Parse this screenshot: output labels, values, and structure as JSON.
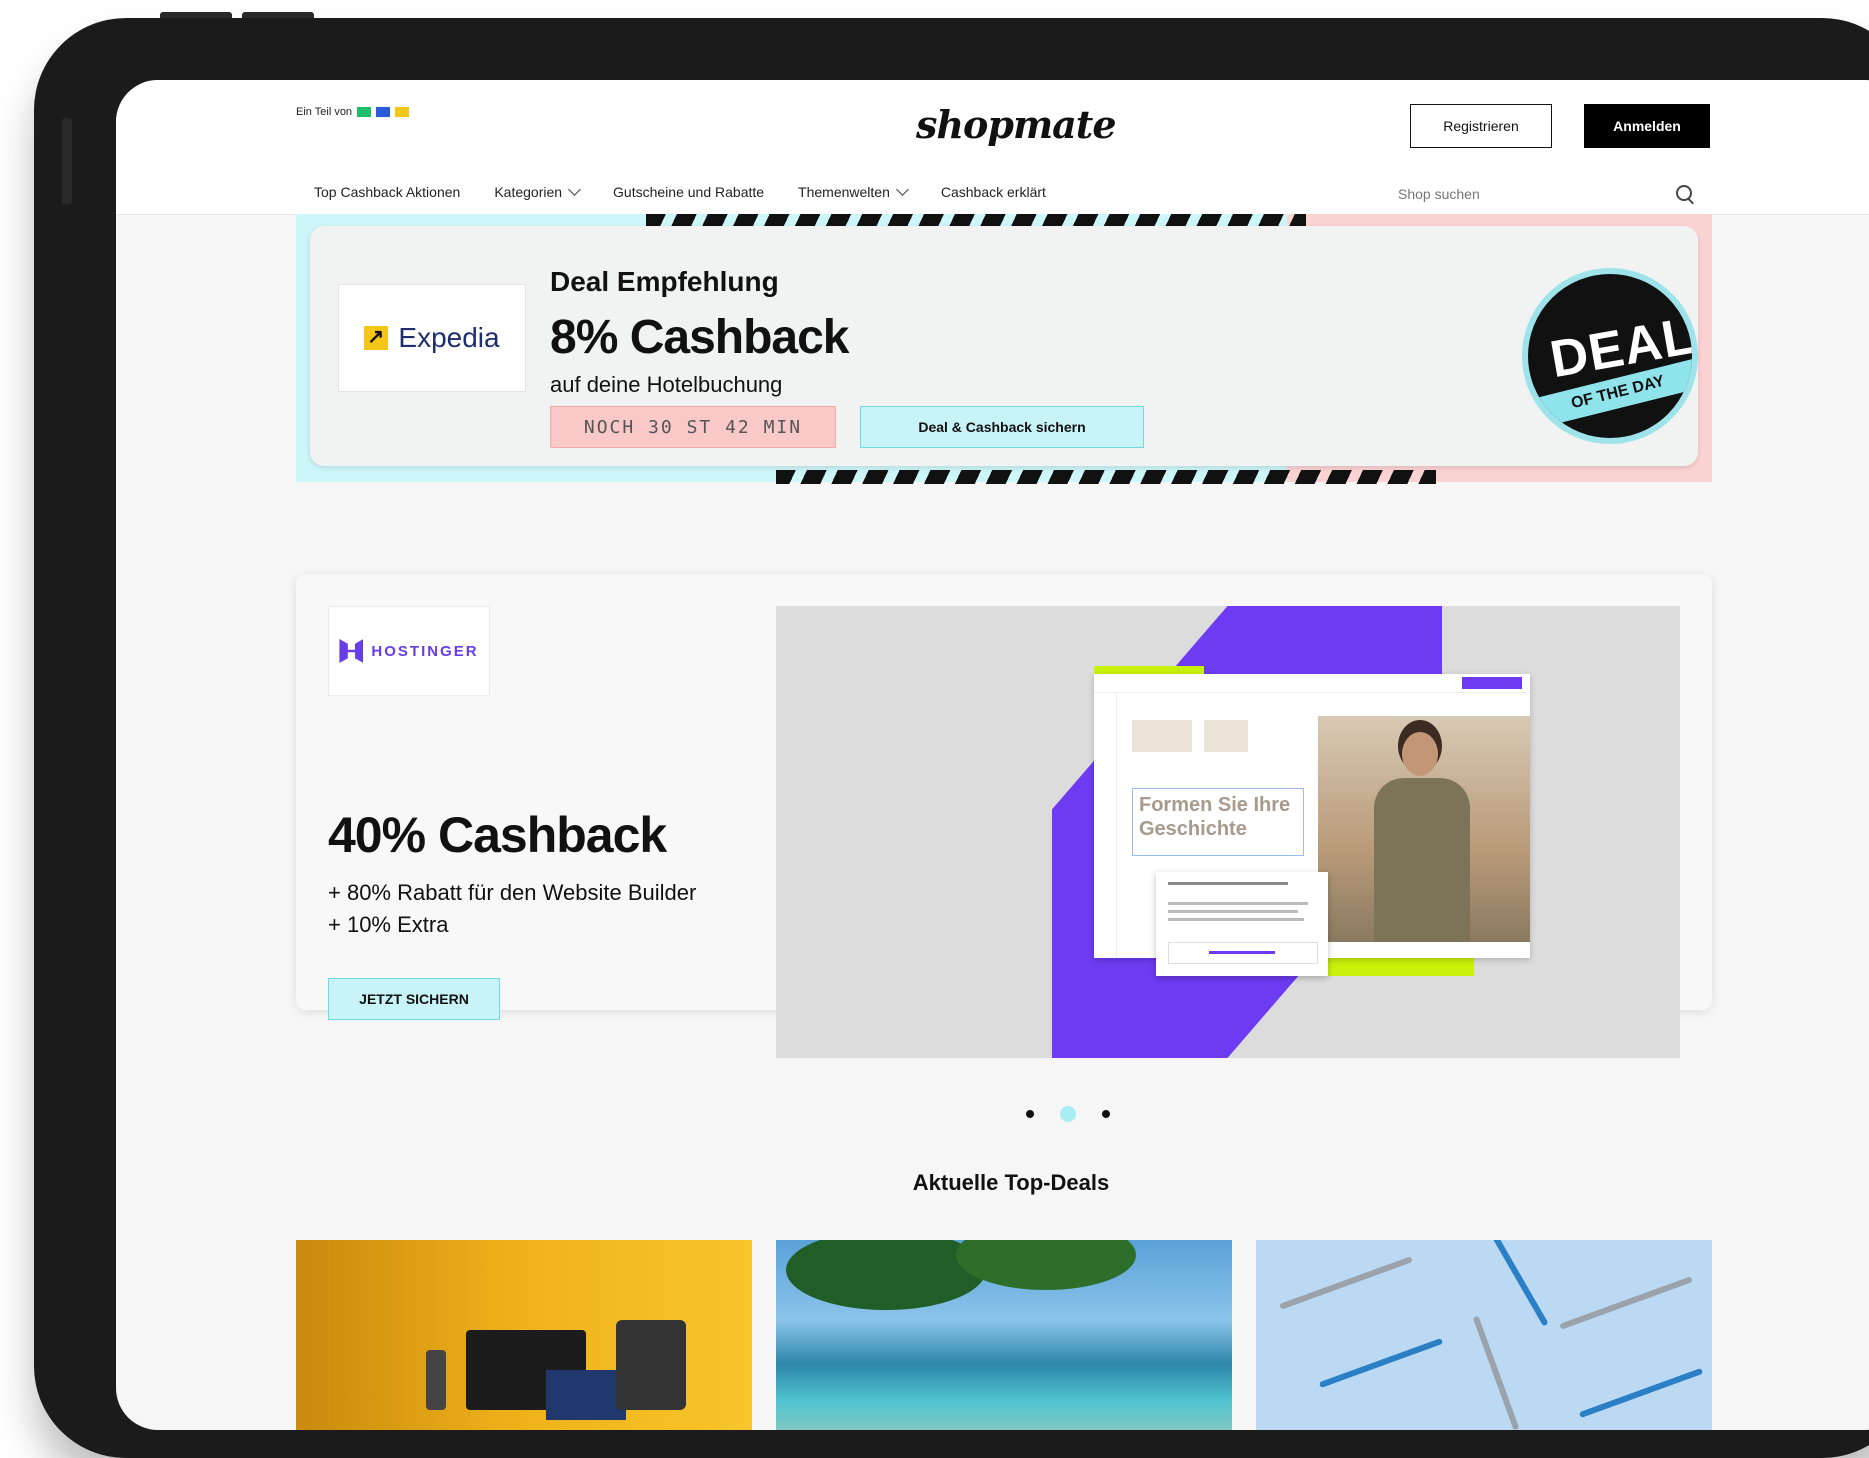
{
  "header": {
    "partner_label": "Ein Teil von",
    "logo": "shopmate",
    "register": "Registrieren",
    "login": "Anmelden",
    "nav": [
      {
        "label": "Top Cashback Aktionen",
        "dropdown": false
      },
      {
        "label": "Kategorien",
        "dropdown": true
      },
      {
        "label": "Gutscheine und Rabatte",
        "dropdown": false
      },
      {
        "label": "Themenwelten",
        "dropdown": true
      },
      {
        "label": "Cashback erklärt",
        "dropdown": false
      }
    ],
    "search_placeholder": "Shop suchen",
    "search_icon": "search-icon"
  },
  "deal": {
    "brand": "Expedia",
    "kicker": "Deal Empfehlung",
    "headline": "8% Cashback",
    "sub": "auf deine Hotelbuchung",
    "countdown": "NOCH 30 ST 42 MIN",
    "button": "Deal & Cashback sichern",
    "badge_big": "DEAL",
    "badge_band": "OF THE DAY"
  },
  "hero": {
    "brand": "HOSTINGER",
    "title": "40% Cashback",
    "line1": "+ 80% Rabatt für den Website Builder",
    "line2": "+ 10% Extra",
    "button": "JETZT SICHERN",
    "media_heading": "Formen Sie Ihre Geschichte",
    "slides_total": 3,
    "slide_active": 2
  },
  "top_deals": {
    "title": "Aktuelle Top-Deals"
  },
  "colors": {
    "accent_cyan": "#c9f4f7",
    "accent_pink": "#fbd3d3",
    "hostinger_purple": "#673de6",
    "lime": "#c8f20a"
  }
}
